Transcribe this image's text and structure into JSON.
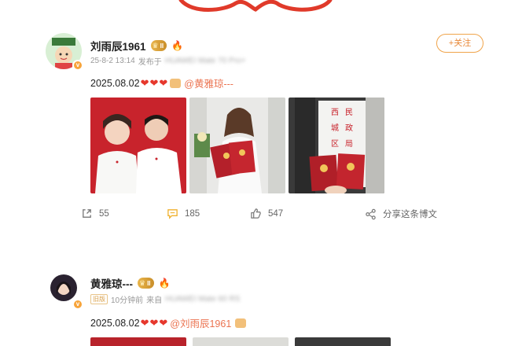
{
  "post1": {
    "username": "刘雨辰1961",
    "level_badge": "II",
    "time": "25-8-2 13:14",
    "source_prefix": "发布于",
    "source_device": "HUAWEI Mate 70 Pro+",
    "follow_label": "+关注",
    "text_date": "2025.08.02",
    "mention": "@黄雅琼---",
    "images": [
      "wedding-photo-couple",
      "bride-with-marriage-certificate",
      "certificates-civil-affairs-bureau"
    ],
    "sign_text": "西民城政区局",
    "actions": {
      "share_count": "55",
      "comment_count": "185",
      "like_count": "547",
      "repost_label": "分享这条博文"
    }
  },
  "post2": {
    "username": "黄雅琼---",
    "level_badge": "II",
    "tag_old": "旧版",
    "time": "10分钟前",
    "source_prefix": "来自",
    "source_device": "HUAWEI Mate 60 RS",
    "text_date": "2025.08.02",
    "mention": "@刘雨辰1961"
  },
  "colors": {
    "accent": "#eb7350",
    "heart": "#e6372c",
    "follow": "#e8893a",
    "badge_gold": "#d9a04b",
    "comment_icon": "#f0b12e"
  },
  "icons": [
    "share-icon",
    "comment-icon",
    "like-icon",
    "repost-icon",
    "flame-icon",
    "crown-icon",
    "heart-icon"
  ]
}
